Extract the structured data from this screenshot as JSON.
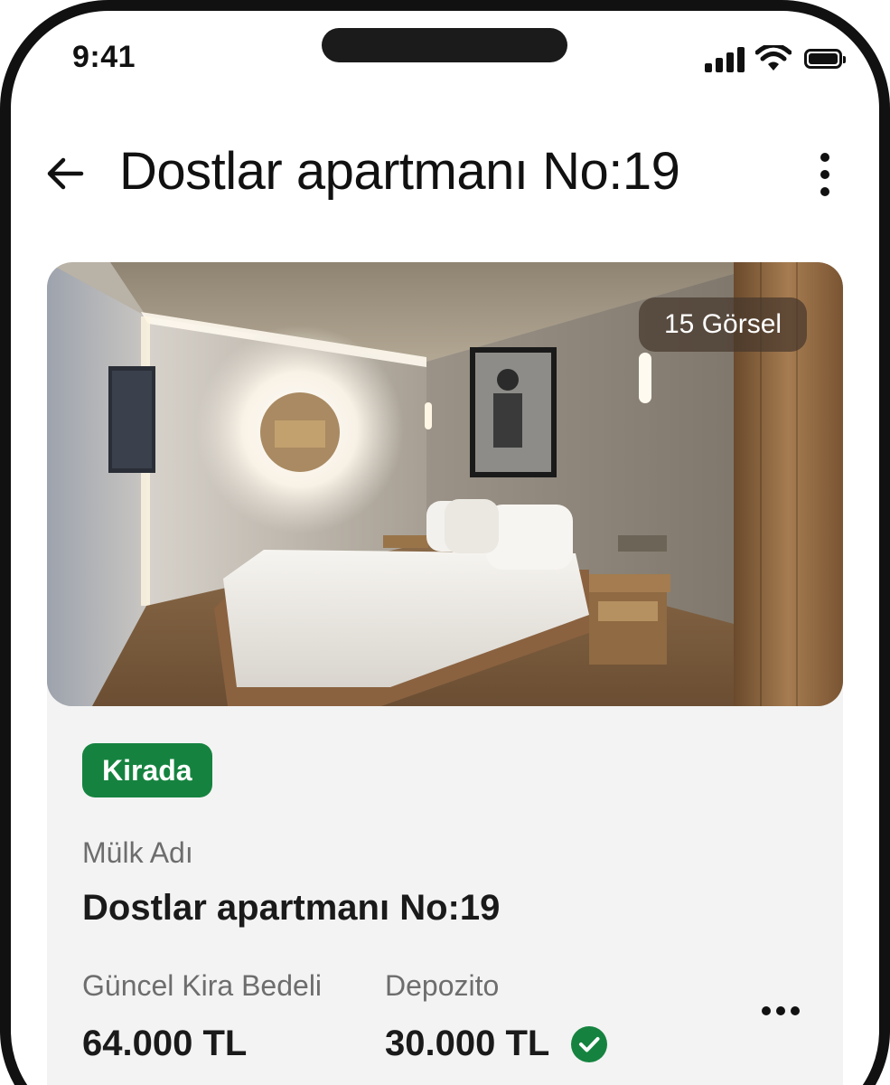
{
  "status_bar": {
    "time": "9:41"
  },
  "header": {
    "title": "Dostlar apartmanı No:19",
    "back_icon": "arrow-left-icon",
    "menu_icon": "kebab-menu-icon"
  },
  "property": {
    "photo_count_label": "15 Görsel",
    "status_label": "Kirada",
    "status_color": "#15833f",
    "name_label": "Mülk Adı",
    "name_value": "Dostlar apartmanı No:19",
    "rent_label": "Güncel Kira Bedeli",
    "rent_value": "64.000 TL",
    "deposit_label": "Depozito",
    "deposit_value": "30.000 TL",
    "deposit_verified_icon": "check-circle-icon"
  }
}
